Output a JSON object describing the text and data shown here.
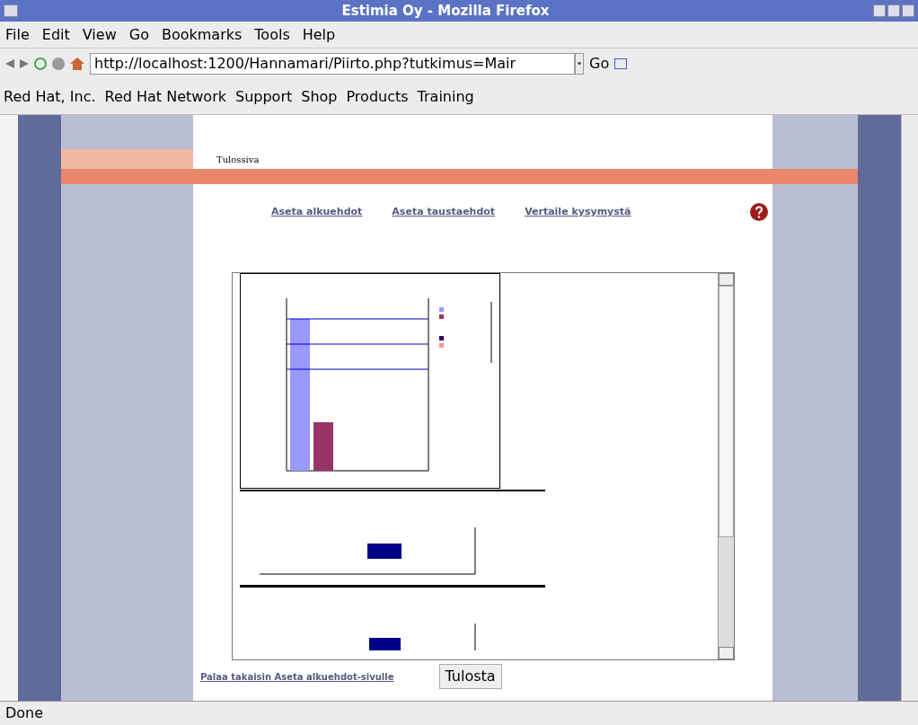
{
  "window": {
    "title": "Estimia Oy - Mozilla Firefox"
  },
  "menu": [
    "File",
    "Edit",
    "View",
    "Go",
    "Bookmarks",
    "Tools",
    "Help"
  ],
  "address": {
    "value": "http://localhost:1200/Hannamari/Piirto.php?tutkimus=Mair",
    "go": "Go"
  },
  "bookmarks": [
    "Red Hat, Inc.",
    "Red Hat Network",
    "Support",
    "Shop",
    "Products",
    "Training"
  ],
  "page": {
    "heading": "Tulossiva",
    "links": [
      "Aseta alkuehdot",
      "Aseta taustaehdot",
      "Vertaile kysymystä"
    ],
    "back_link": "Palaa takaisin Aseta alkuehdot-sivulle",
    "print_button": "Tulosta"
  },
  "status_bar": "Done"
}
